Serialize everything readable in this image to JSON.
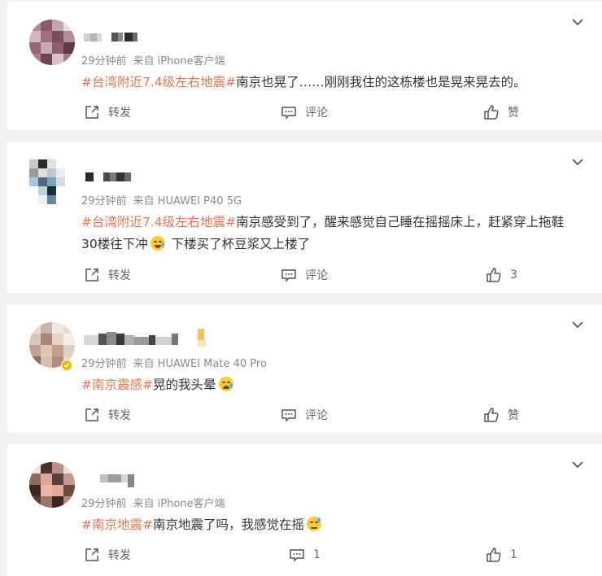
{
  "posts": [
    {
      "time": "29分钟前",
      "source": "来自 iPhone客户端",
      "segments": [
        {
          "text": "#台湾附近7.4级左右地震#",
          "tag": true
        },
        {
          "text": "南京也晃了……刚刚我住的这栋楼也是晃来晃去的。",
          "tag": false
        }
      ],
      "repost_label": "转发",
      "comment_label": "评论",
      "like_label": "赞"
    },
    {
      "time": "29分钟前",
      "source": "来自 HUAWEI P40 5G",
      "segments": [
        {
          "text": "#台湾附近7.4级左右地震#",
          "tag": true
        },
        {
          "text": "南京感受到了，醒来感觉自己睡在摇摇床上，赶紧穿上拖鞋30楼往下冲",
          "tag": false
        },
        {
          "emoji": "crying-laughing-emoji"
        },
        {
          "text": " 下楼买了杯豆浆又上楼了",
          "tag": false
        }
      ],
      "repost_label": "转发",
      "comment_label": "评论",
      "like_label": "3"
    },
    {
      "time": "29分钟前",
      "source": "来自 HUAWEI Mate 40 Pro",
      "segments": [
        {
          "text": "#南京震感#",
          "tag": true
        },
        {
          "text": "晃的我头晕",
          "tag": false
        },
        {
          "emoji": "crying-emoji"
        }
      ],
      "repost_label": "转发",
      "comment_label": "评论",
      "like_label": "赞"
    },
    {
      "time": "29分钟前",
      "source": "来自 iPhone客户端",
      "segments": [
        {
          "text": "#南京地震#",
          "tag": true
        },
        {
          "text": "南京地震了吗，我感觉在摇",
          "tag": false
        },
        {
          "emoji": "sweat-emoji"
        }
      ],
      "repost_label": "转发",
      "comment_label": "1",
      "like_label": "1"
    }
  ],
  "colors": {
    "tag": "#eb7350",
    "meta": "#8a8a8a",
    "text": "#333333",
    "action": "#666666",
    "background": "#f2f2f2"
  }
}
